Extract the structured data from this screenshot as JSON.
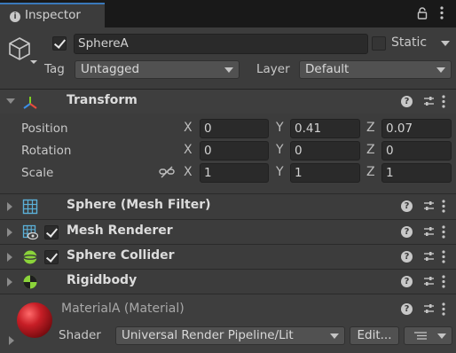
{
  "tab": {
    "title": "Inspector"
  },
  "object": {
    "active": true,
    "name": "SphereA",
    "static_label": "Static",
    "tag_label": "Tag",
    "tag_value": "Untagged",
    "layer_label": "Layer",
    "layer_value": "Default"
  },
  "transform": {
    "title": "Transform",
    "position_label": "Position",
    "rotation_label": "Rotation",
    "scale_label": "Scale",
    "axis_x": "X",
    "axis_y": "Y",
    "axis_z": "Z",
    "position": {
      "x": "0",
      "y": "0.41",
      "z": "0.07"
    },
    "rotation": {
      "x": "0",
      "y": "0",
      "z": "0"
    },
    "scale": {
      "x": "1",
      "y": "1",
      "z": "1"
    }
  },
  "components": [
    {
      "title": "Sphere (Mesh Filter)",
      "icon": "mesh-filter-icon",
      "has_checkbox": false
    },
    {
      "title": "Mesh Renderer",
      "icon": "mesh-renderer-icon",
      "has_checkbox": true
    },
    {
      "title": "Sphere Collider",
      "icon": "sphere-collider-icon",
      "has_checkbox": true
    },
    {
      "title": "Rigidbody",
      "icon": "rigidbody-icon",
      "has_checkbox": false
    }
  ],
  "material": {
    "name": "MaterialA (Material)",
    "shader_label": "Shader",
    "shader_value": "Universal Render Pipeline/Lit",
    "edit_label": "Edit...",
    "preview_color": "#b01c22"
  },
  "colors": {
    "accent": "#3a79bb",
    "panel": "#3c3c3c"
  }
}
